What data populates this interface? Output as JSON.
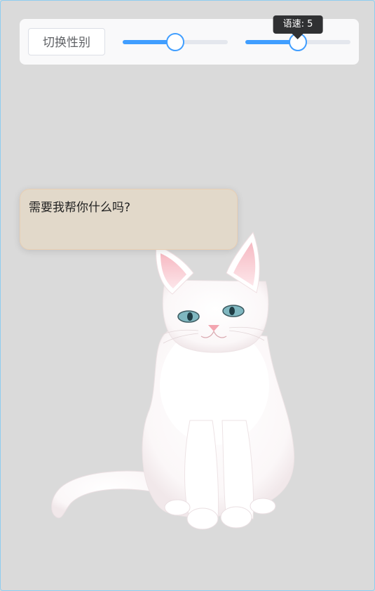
{
  "toolbar": {
    "gender_button_label": "切换性别",
    "pitch_slider": {
      "value": 0.5
    },
    "speed_slider": {
      "value": 0.5,
      "tooltip": "语速: 5"
    }
  },
  "speech_bubble": {
    "text": "需要我帮你什么吗?"
  },
  "mascot": {
    "icon": "white-cat-icon"
  },
  "colors": {
    "background": "#dadada",
    "accent": "#409eff",
    "bubble": "#e2d9ca",
    "tooltip": "#303133"
  }
}
